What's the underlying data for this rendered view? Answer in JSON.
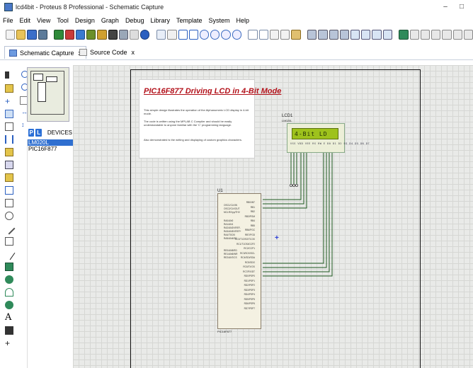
{
  "window": {
    "title": "lcd4bit - Proteus 8 Professional - Schematic Capture",
    "min_label": "–",
    "max_label": "□"
  },
  "menu": [
    "File",
    "Edit",
    "View",
    "Tool",
    "Design",
    "Graph",
    "Debug",
    "Library",
    "Template",
    "System",
    "Help"
  ],
  "tabs": [
    {
      "label": "Schematic Capture",
      "close": "x",
      "icon": "schematic-icon"
    },
    {
      "label": "Source Code",
      "close": "x",
      "icon": "source-code-icon"
    }
  ],
  "devices_panel": {
    "p_button": "P",
    "l_button": "L",
    "header": "DEVICES",
    "items": [
      "LM020L",
      "PIC16F877"
    ],
    "selected_index": 0
  },
  "schematic": {
    "info_title": "PIC16F877 Driving LCD in 4-Bit Mode",
    "info_lines": [
      "This simple design illustrates the operation of the Alphanumeric LCD display in 4-bit mode.",
      "The code is written using the MPLAB C Compiler and should be easily understandable to anyone familiar with the 'C' programming language.",
      "Also demonstrated is the writing and displaying of custom graphics characters."
    ],
    "lcd_ref": "LCD1",
    "lcd_part": "LM020L",
    "lcd_text": "4-Bit LD",
    "lcd_pins": "VSS VDD VEE  RS RW E  D0 D1 D2 D3 D4 D5 D6 D7",
    "mcu_ref": "U1",
    "mcu_part": "PIC16F877",
    "mcu_left_pins": [
      "OSC1/CLKIN",
      "OSC2/CLKOUT",
      "MCLR/Vpp/THV",
      "RA0/AN0",
      "RA1/AN1",
      "RA2/AN2/VREF-",
      "RA3/AN3/VREF+",
      "RA4/T0CKI",
      "RA5/AN4/SS",
      "RE0/AN5/RD",
      "RE1/AN6/WR",
      "RE2/AN7/CS"
    ],
    "mcu_right_pins": [
      "RB0/INT",
      "RB1",
      "RB2",
      "RB3/PGM",
      "RB4",
      "RB5",
      "RB6/PGC",
      "RB7/PGD",
      "RC0/T1OSO/T1CKI",
      "RC1/T1OSI/CCP2",
      "RC2/CCP1",
      "RC3/SCK/SCL",
      "RC4/SDI/SDA",
      "RC5/SDO",
      "RC6/TX/CK",
      "RC7/RX/DT",
      "RD0/PSP0",
      "RD1/PSP1",
      "RD2/PSP2",
      "RD3/PSP3",
      "RD4/PSP4",
      "RD5/PSP5",
      "RD6/PSP6",
      "RD7/PSP7"
    ]
  }
}
